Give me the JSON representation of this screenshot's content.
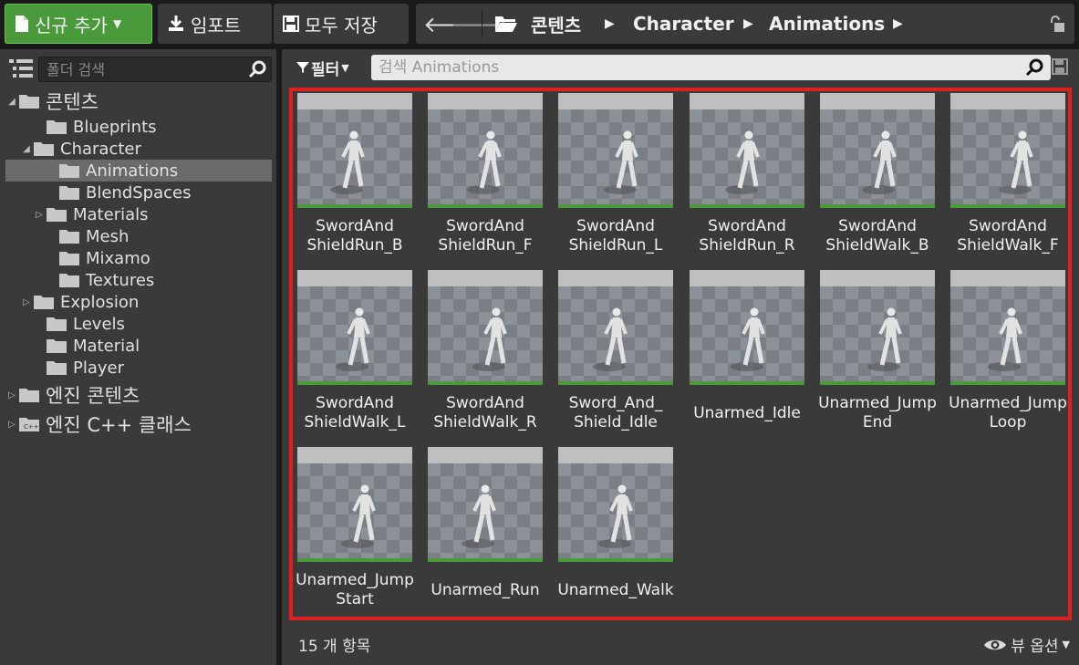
{
  "toolbar": {
    "add_new_label": "신규 추가",
    "import_label": "임포트",
    "save_all_label": "모두 저장"
  },
  "breadcrumb": {
    "items": [
      "콘텐츠",
      "Character",
      "Animations"
    ]
  },
  "sidebar": {
    "search_placeholder": "폴더 검색",
    "tree": [
      {
        "label": "콘텐츠",
        "expander": "◢"
      },
      {
        "label": "Blueprints",
        "expander": ""
      },
      {
        "label": "Character",
        "expander": "◢"
      },
      {
        "label": "Animations",
        "expander": "",
        "selected": true
      },
      {
        "label": "BlendSpaces",
        "expander": ""
      },
      {
        "label": "Materials",
        "expander": "▷"
      },
      {
        "label": "Mesh",
        "expander": ""
      },
      {
        "label": "Mixamo",
        "expander": ""
      },
      {
        "label": "Textures",
        "expander": ""
      },
      {
        "label": "Explosion",
        "expander": "▷"
      },
      {
        "label": "Levels",
        "expander": ""
      },
      {
        "label": "Material",
        "expander": ""
      },
      {
        "label": "Player",
        "expander": ""
      },
      {
        "label": "엔진 콘텐츠",
        "expander": "▷"
      },
      {
        "label": "엔진 C++ 클래스",
        "expander": "▷"
      }
    ]
  },
  "content": {
    "filter_label": "필터",
    "search_placeholder": "검색 Animations",
    "assets": [
      {
        "name": "SwordAnd ShieldRun_B"
      },
      {
        "name": "SwordAnd ShieldRun_F"
      },
      {
        "name": "SwordAnd ShieldRun_L"
      },
      {
        "name": "SwordAnd ShieldRun_R"
      },
      {
        "name": "SwordAnd ShieldWalk_B"
      },
      {
        "name": "SwordAnd ShieldWalk_F"
      },
      {
        "name": "SwordAnd ShieldWalk_L"
      },
      {
        "name": "SwordAnd ShieldWalk_R"
      },
      {
        "name": "Sword_And_ Shield_Idle"
      },
      {
        "name": "Unarmed_Idle"
      },
      {
        "name": "Unarmed_Jump End"
      },
      {
        "name": "Unarmed_Jump Loop"
      },
      {
        "name": "Unarmed_Jump Start"
      },
      {
        "name": "Unarmed_Run"
      },
      {
        "name": "Unarmed_Walk"
      }
    ],
    "status_text": "15 개 항목",
    "view_options_label": "뷰 옵션"
  },
  "colors": {
    "add_button": "#4a9a3c",
    "selection_outline": "#e02020",
    "selected_tree_item": "#6a6a6a"
  }
}
